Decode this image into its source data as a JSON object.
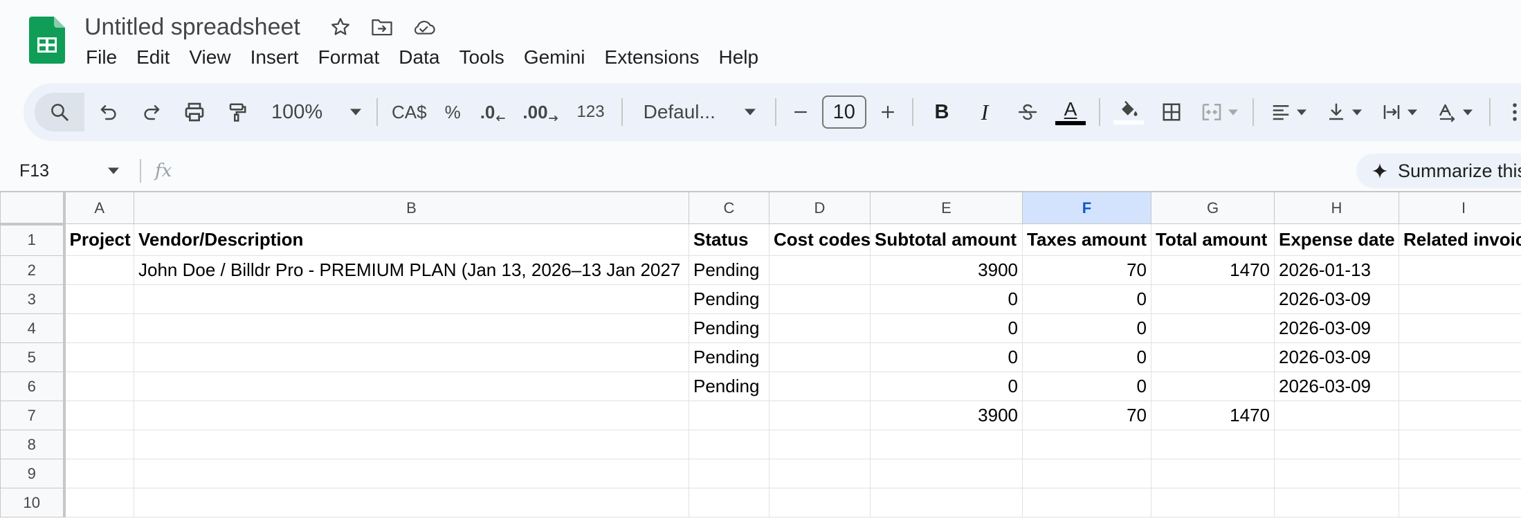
{
  "app": {
    "title": "Untitled spreadsheet",
    "brand_color": "#0f9d58"
  },
  "menu": [
    "File",
    "Edit",
    "View",
    "Insert",
    "Format",
    "Data",
    "Tools",
    "Gemini",
    "Extensions",
    "Help"
  ],
  "toolbar": {
    "zoom": "100%",
    "currency": "CA$",
    "percent": "%",
    "decrease_decimal": ".0",
    "increase_decimal": ".00",
    "number_format": "123",
    "font": "Defaul...",
    "font_size": "10",
    "bold": "B",
    "italic": "I",
    "text_color_label": "A",
    "text_color": "#000000"
  },
  "formula_bar": {
    "cell_ref": "F13",
    "fx_label": "fx",
    "formula": "",
    "summarize_label": "Summarize this"
  },
  "sheet": {
    "columns": [
      "A",
      "B",
      "C",
      "D",
      "E",
      "F",
      "G",
      "H",
      "I"
    ],
    "selected_column": "F",
    "row_numbers": [
      "1",
      "2",
      "3",
      "4",
      "5",
      "6",
      "7",
      "8",
      "9",
      "10"
    ],
    "header": [
      "Project",
      "Vendor/Description",
      "Status",
      "Cost codes",
      "Subtotal amount",
      "Taxes amount",
      "Total amount",
      "Expense date",
      "Related invoic"
    ],
    "rows": [
      [
        "",
        "John Doe / Billdr Pro - PREMIUM PLAN (Jan 13, 2026–13 Jan 2027",
        "Pending",
        "",
        "3900",
        "70",
        "1470",
        "2026-01-13",
        ""
      ],
      [
        "",
        "",
        "Pending",
        "",
        "0",
        "0",
        "",
        "2026-03-09",
        ""
      ],
      [
        "",
        "",
        "Pending",
        "",
        "0",
        "0",
        "",
        "2026-03-09",
        ""
      ],
      [
        "",
        "",
        "Pending",
        "",
        "0",
        "0",
        "",
        "2026-03-09",
        ""
      ],
      [
        "",
        "",
        "Pending",
        "",
        "0",
        "0",
        "",
        "2026-03-09",
        ""
      ],
      [
        "",
        "",
        "",
        "",
        "3900",
        "70",
        "1470",
        "",
        ""
      ],
      [
        "",
        "",
        "",
        "",
        "",
        "",
        "",
        "",
        ""
      ],
      [
        "",
        "",
        "",
        "",
        "",
        "",
        "",
        "",
        ""
      ],
      [
        "",
        "",
        "",
        "",
        "",
        "",
        "",
        "",
        ""
      ]
    ]
  }
}
